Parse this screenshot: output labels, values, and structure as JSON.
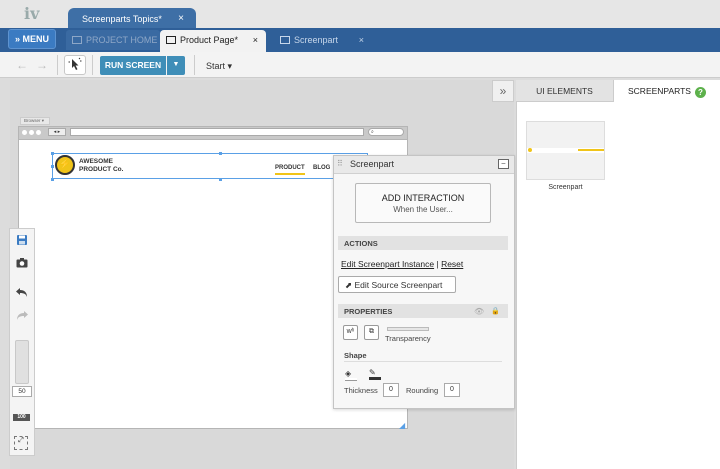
{
  "app": {
    "logo_text": "iv",
    "project_tab": "Screenparts Topics*",
    "close_symbol": "×"
  },
  "menu": {
    "label": "» MENU"
  },
  "tabs": [
    {
      "label": "PROJECT HOME",
      "icon": "folder-icon"
    },
    {
      "label": "Product Page*",
      "icon": "page-icon",
      "active": true
    },
    {
      "label": "Screenpart",
      "icon": "screenpart-icon"
    }
  ],
  "toolbar": {
    "back": "←",
    "forward": "→",
    "run_label": "RUN SCREEN",
    "run_dropdown": "▼",
    "start_label": "Start ▾"
  },
  "canvas": {
    "collapse": "»",
    "browser_label": "Browser ▾",
    "url": "",
    "brand_line1": "AWESOME",
    "brand_line2": "PRODUCT Co.",
    "bolt": "⚡",
    "nav": [
      "PRODUCT",
      "BLOG"
    ],
    "zoom_value": "50",
    "zoom_100": "100"
  },
  "screenpart_panel": {
    "title": "Screenpart",
    "add_interaction": "ADD INTERACTION",
    "when_user": "When the User...",
    "actions_heading": "ACTIONS",
    "edit_instance": "Edit Screenpart Instance",
    "separator": "|",
    "reset": "Reset",
    "edit_source": "Edit Source Screenpart",
    "properties_heading": "PROPERTIES",
    "transparency": "Transparency",
    "shape": "Shape",
    "thickness_label": "Thickness",
    "thickness_value": "0",
    "rounding_label": "Rounding",
    "rounding_value": "0"
  },
  "right_panel": {
    "tab_ui": "UI ELEMENTS",
    "tab_screenparts": "SCREENPARTS",
    "help": "?",
    "thumb_label": "Screenpart"
  },
  "colors": {
    "brand_blue": "#2f5f98",
    "run_button": "#3f8eb8",
    "accent_yellow": "#f0c419",
    "selection_blue": "#5aa0e6",
    "help_green": "#5db14b"
  }
}
